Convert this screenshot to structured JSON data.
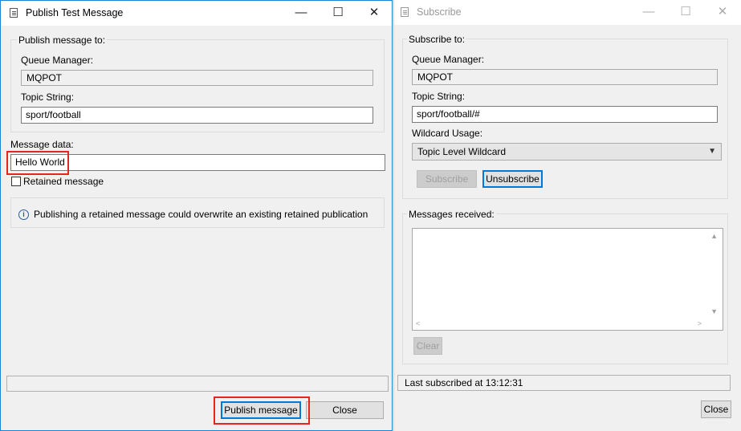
{
  "publish_window": {
    "title": "Publish Test Message",
    "window_controls": {
      "minimize": "—",
      "maximize": "☐",
      "close": "✕"
    },
    "publish_to_group": "Publish message to:",
    "queue_manager_label": "Queue Manager:",
    "queue_manager_value": "MQPOT",
    "topic_string_label": "Topic String:",
    "topic_string_value": "sport/football",
    "message_data_label": "Message data:",
    "message_data_value": "Hello World",
    "retained_label": "Retained message",
    "info_icon": "i",
    "info_text": "Publishing a retained message could overwrite an existing retained publication",
    "status_text": "",
    "publish_button": "Publish message",
    "close_button": "Close"
  },
  "subscribe_window": {
    "title": "Subscribe",
    "window_controls": {
      "minimize": "—",
      "maximize": "☐",
      "close": "✕"
    },
    "subscribe_to_group": "Subscribe to:",
    "queue_manager_label": "Queue Manager:",
    "queue_manager_value": "MQPOT",
    "topic_string_label": "Topic String:",
    "topic_string_value": "sport/football/#",
    "wildcard_label": "Wildcard Usage:",
    "wildcard_value": "Topic Level Wildcard",
    "subscribe_button": "Subscribe",
    "unsubscribe_button": "Unsubscribe",
    "messages_group": "Messages received:",
    "messages_text": "",
    "clear_button": "Clear",
    "status_text": "Last subscribed at 13:12:31",
    "close_button": "Close"
  },
  "colors": {
    "highlight": "#e5261e",
    "focus": "#0078d7"
  }
}
